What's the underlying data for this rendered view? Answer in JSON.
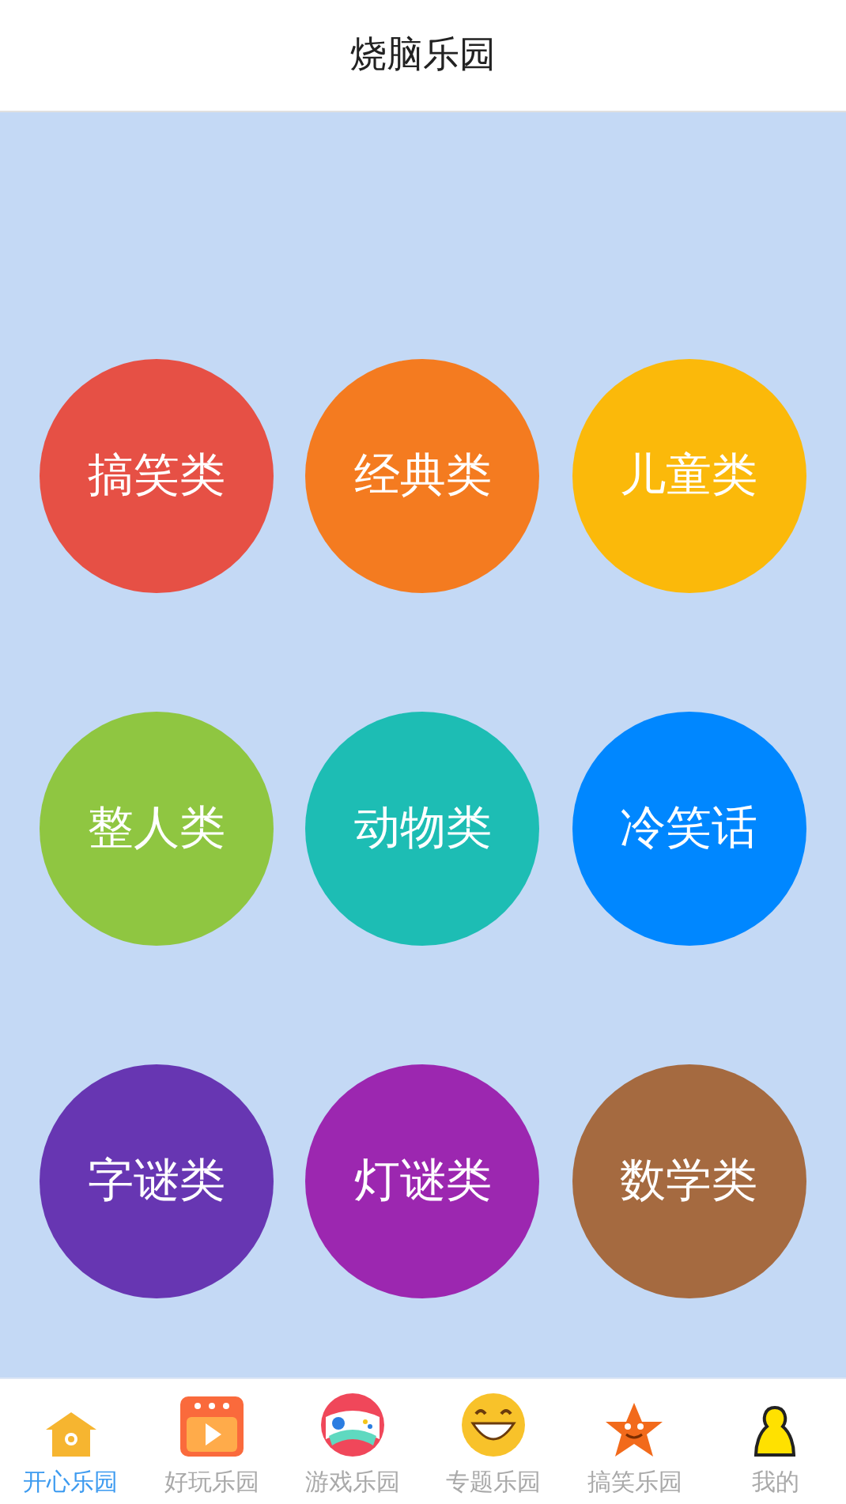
{
  "header": {
    "title": "烧脑乐园"
  },
  "categories": [
    {
      "label": "搞笑类",
      "color": "#e65045"
    },
    {
      "label": "经典类",
      "color": "#f47b20"
    },
    {
      "label": "儿童类",
      "color": "#fbb90a"
    },
    {
      "label": "整人类",
      "color": "#8fc641"
    },
    {
      "label": "动物类",
      "color": "#1dbdb4"
    },
    {
      "label": "冷笑话",
      "color": "#0087ff"
    },
    {
      "label": "字谜类",
      "color": "#6736b2"
    },
    {
      "label": "灯谜类",
      "color": "#9c27b0"
    },
    {
      "label": "数学类",
      "color": "#a56a40"
    }
  ],
  "tabs": [
    {
      "label": "开心乐园",
      "kind": "house",
      "selected": true
    },
    {
      "label": "好玩乐园",
      "kind": "video",
      "selected": false
    },
    {
      "label": "游戏乐园",
      "kind": "gamepad",
      "selected": false
    },
    {
      "label": "专题乐园",
      "kind": "smiley",
      "selected": false
    },
    {
      "label": "搞笑乐园",
      "kind": "star",
      "selected": false
    },
    {
      "label": "我的",
      "kind": "person",
      "selected": false
    }
  ]
}
